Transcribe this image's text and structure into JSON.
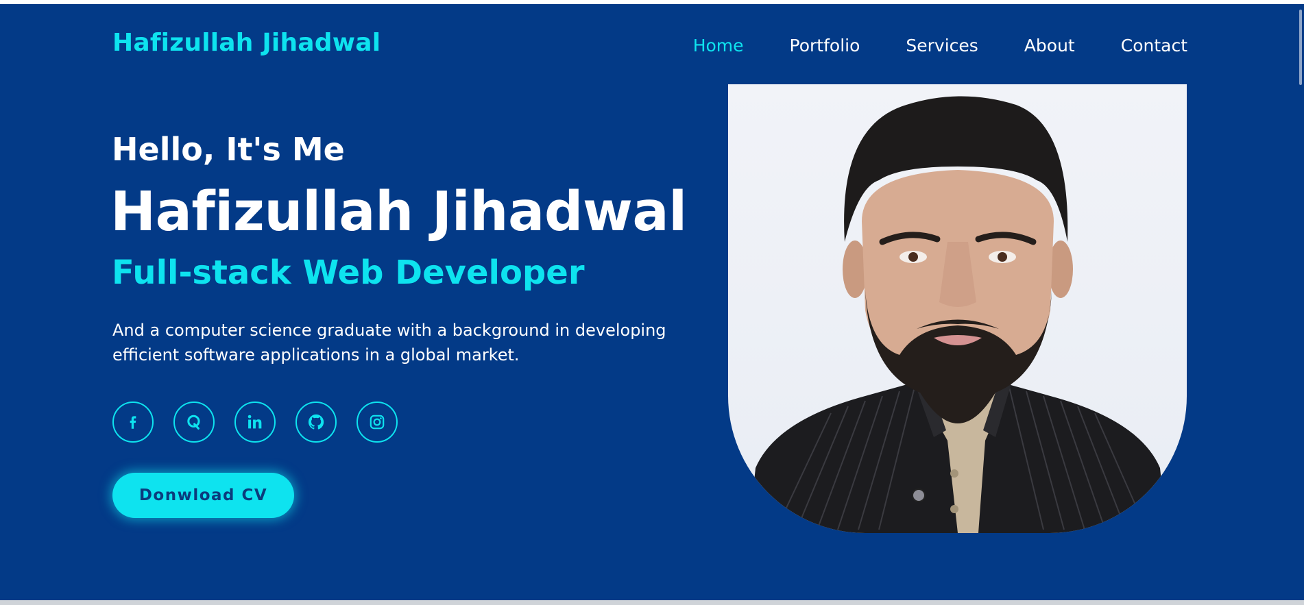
{
  "header": {
    "logo": "Hafizullah Jihadwal",
    "nav": [
      {
        "label": "Home",
        "active": true
      },
      {
        "label": "Portfolio",
        "active": false
      },
      {
        "label": "Services",
        "active": false
      },
      {
        "label": "About",
        "active": false
      },
      {
        "label": "Contact",
        "active": false
      }
    ]
  },
  "hero": {
    "greeting": "Hello, It's Me",
    "name": "Hafizullah Jihadwal",
    "role": "Full-stack Web Developer",
    "description_line1": "And a computer science graduate with a background in developing",
    "description_line2": "efficient software applications in a global market.",
    "socials": [
      {
        "icon": "facebook-icon"
      },
      {
        "icon": "quora-icon"
      },
      {
        "icon": "linkedin-icon"
      },
      {
        "icon": "github-icon"
      },
      {
        "icon": "instagram-icon"
      }
    ],
    "cv_button": "Donwload CV",
    "photo_icon": "profile-photo"
  },
  "colors": {
    "background": "#033a87",
    "accent": "#0ee3ef",
    "text": "#ffffff",
    "button_text": "#0b3b7c"
  }
}
